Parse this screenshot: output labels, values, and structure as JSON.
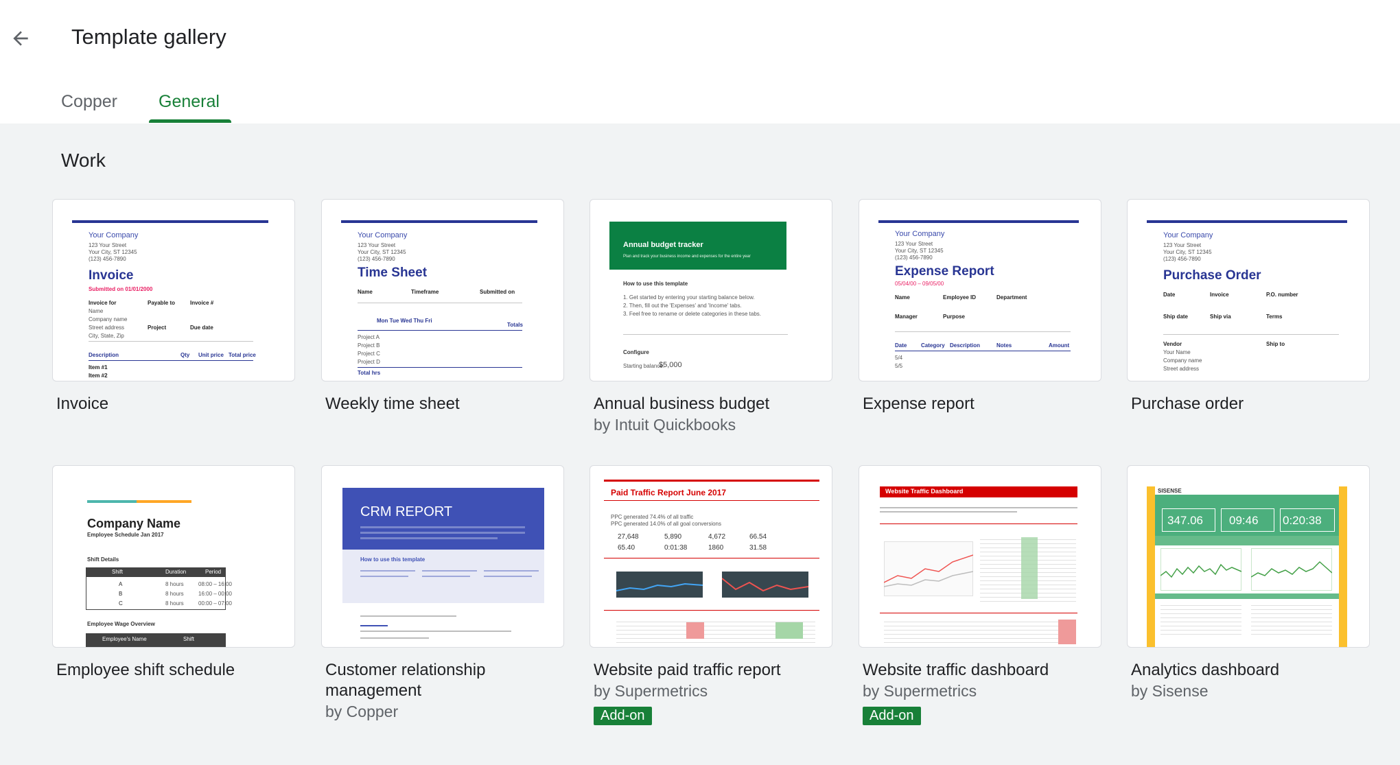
{
  "header": {
    "title": "Template gallery",
    "tabs": [
      {
        "label": "Copper",
        "active": false
      },
      {
        "label": "General",
        "active": true
      }
    ]
  },
  "section": {
    "title": "Work"
  },
  "badge_label": "Add-on",
  "templates": [
    {
      "title": "Invoice",
      "subtitle": "",
      "addon": false,
      "preview": {
        "company": "Your Company",
        "heading": "Invoice",
        "sub": "Submitted on 01/01/2000"
      }
    },
    {
      "title": "Weekly time sheet",
      "subtitle": "",
      "addon": false,
      "preview": {
        "company": "Your Company",
        "heading": "Time Sheet"
      }
    },
    {
      "title": "Annual business budget",
      "subtitle": "by Intuit Quickbooks",
      "addon": false,
      "preview": {
        "banner": "Annual budget tracker",
        "banner_sub": "Plan and track your business income and expenses for the entire year",
        "how": "How to use this template",
        "configure": "Configure",
        "balance_label": "Starting balance:",
        "balance": "$5,000"
      }
    },
    {
      "title": "Expense report",
      "subtitle": "",
      "addon": false,
      "preview": {
        "company": "Your Company",
        "heading": "Expense Report"
      }
    },
    {
      "title": "Purchase order",
      "subtitle": "",
      "addon": false,
      "preview": {
        "company": "Your Company",
        "heading": "Purchase Order"
      }
    },
    {
      "title": "Employee shift schedule",
      "subtitle": "",
      "addon": false,
      "preview": {
        "heading": "Company Name",
        "sub": "Employee Schedule Jan 2017",
        "rows": [
          "A",
          "B",
          "C"
        ]
      }
    },
    {
      "title": "Customer relationship management",
      "subtitle": "by Copper",
      "addon": false,
      "preview": {
        "heading": "CRM REPORT",
        "how": "How to use this template"
      }
    },
    {
      "title": "Website paid traffic report",
      "subtitle": "by Supermetrics",
      "addon": true,
      "preview": {
        "heading": "Paid Traffic Report June 2017",
        "kpis": [
          "27,648",
          "5,890",
          "4,672",
          "66.54",
          "65.40",
          "0:01:38",
          "1860",
          "31.58"
        ]
      }
    },
    {
      "title": "Website traffic dashboard",
      "subtitle": "by Supermetrics",
      "addon": true,
      "preview": {
        "heading": "Website Traffic Dashboard"
      }
    },
    {
      "title": "Analytics dashboard",
      "subtitle": "by Sisense",
      "addon": false,
      "preview": {
        "brand": "SISENSE",
        "kpis": [
          "347.06",
          "09:46",
          "0:20:38"
        ]
      }
    }
  ],
  "icons": {
    "back": "arrow-back-icon"
  },
  "colors": {
    "accent": "#188038",
    "doc_blue": "#283593",
    "sisense_yellow": "#fbc02d",
    "supermetrics_red": "#d50000"
  }
}
